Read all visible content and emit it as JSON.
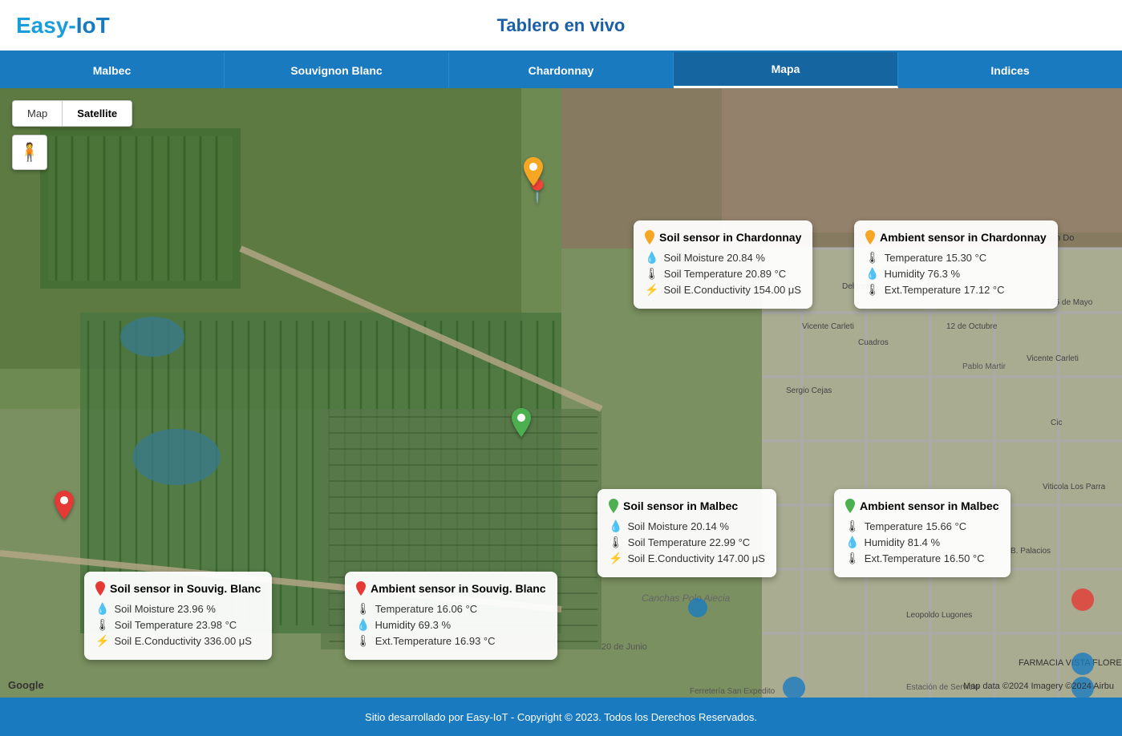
{
  "header": {
    "logo": "Easy-IoT",
    "logo_easy": "Easy-",
    "logo_iot": "IoT",
    "title": "Tablero en vivo"
  },
  "nav": {
    "tabs": [
      {
        "id": "malbec",
        "label": "Malbec",
        "active": false
      },
      {
        "id": "sauvignon-blanc",
        "label": "Souvignon Blanc",
        "active": false
      },
      {
        "id": "chardonnay",
        "label": "Chardonnay",
        "active": false
      },
      {
        "id": "mapa",
        "label": "Mapa",
        "active": true
      },
      {
        "id": "indices",
        "label": "Indices",
        "active": false
      }
    ]
  },
  "map": {
    "map_btn": "Map",
    "satellite_btn": "Satellite",
    "google_label": "Google",
    "attribution": "Map data ©2024 Imagery ©2024 Airbu",
    "person_icon": "🧍"
  },
  "sensors": {
    "soil_souvignon": {
      "title": "Soil sensor in Souvig. Blanc",
      "pin_color": "red",
      "pin_symbol": "📍",
      "rows": [
        {
          "icon": "💧",
          "label": "Soil Moisture 23.96 %"
        },
        {
          "icon": "🌡",
          "label": "Soil Temperature 23.98 °C"
        },
        {
          "icon": "⚡",
          "label": "Soil E.Conductivity 336.00 μS"
        }
      ]
    },
    "ambient_souvignon": {
      "title": "Ambient sensor in Souvig. Blanc",
      "pin_color": "red",
      "rows": [
        {
          "icon": "🌡",
          "label": "Temperature 16.06 °C"
        },
        {
          "icon": "💧",
          "label": "Humidity 69.3 %"
        },
        {
          "icon": "🌡",
          "label": "Ext.Temperature 16.93 °C"
        }
      ]
    },
    "soil_chardonnay": {
      "title": "Soil sensor in Chardonnay",
      "pin_color": "orange",
      "rows": [
        {
          "icon": "💧",
          "label": "Soil Moisture 20.84 %"
        },
        {
          "icon": "🌡",
          "label": "Soil Temperature 20.89 °C"
        },
        {
          "icon": "⚡",
          "label": "Soil E.Conductivity 154.00 μS"
        }
      ]
    },
    "ambient_chardonnay": {
      "title": "Ambient sensor in Chardonnay",
      "pin_color": "orange",
      "rows": [
        {
          "icon": "🌡",
          "label": "Temperature 15.30 °C"
        },
        {
          "icon": "💧",
          "label": "Humidity 76.3 %"
        },
        {
          "icon": "🌡",
          "label": "Ext.Temperature 17.12 °C"
        }
      ]
    },
    "soil_malbec": {
      "title": "Soil sensor in Malbec",
      "pin_color": "green",
      "rows": [
        {
          "icon": "💧",
          "label": "Soil Moisture 20.14 %"
        },
        {
          "icon": "🌡",
          "label": "Soil Temperature 22.99 °C"
        },
        {
          "icon": "⚡",
          "label": "Soil E.Conductivity 147.00 μS"
        }
      ]
    },
    "ambient_malbec": {
      "title": "Ambient sensor in Malbec",
      "pin_color": "green",
      "rows": [
        {
          "icon": "🌡",
          "label": "Temperature 15.66 °C"
        },
        {
          "icon": "💧",
          "label": "Humidity 81.4 %"
        },
        {
          "icon": "🌡",
          "label": "Ext.Temperature 16.50 °C"
        }
      ]
    }
  },
  "footer": {
    "text": "Sitio desarrollado por Easy-IoT - Copyright © 2023. Todos los Derechos Reservados."
  }
}
